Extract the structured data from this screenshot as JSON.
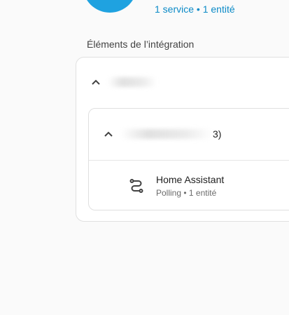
{
  "header": {
    "service_link": "1 service",
    "separator": "•",
    "entity_link": "1 entité"
  },
  "section": {
    "title": "Éléments de l’intégration"
  },
  "group": {
    "device": {
      "name_suffix": "3)",
      "entry": {
        "title": "Home Assistant",
        "subtitle": "Polling • 1 entité",
        "icon": "integration-link-icon"
      }
    }
  },
  "colors": {
    "accent": "#0b8ac7",
    "brand": "#1fa2e0",
    "background": "#fafafa"
  }
}
